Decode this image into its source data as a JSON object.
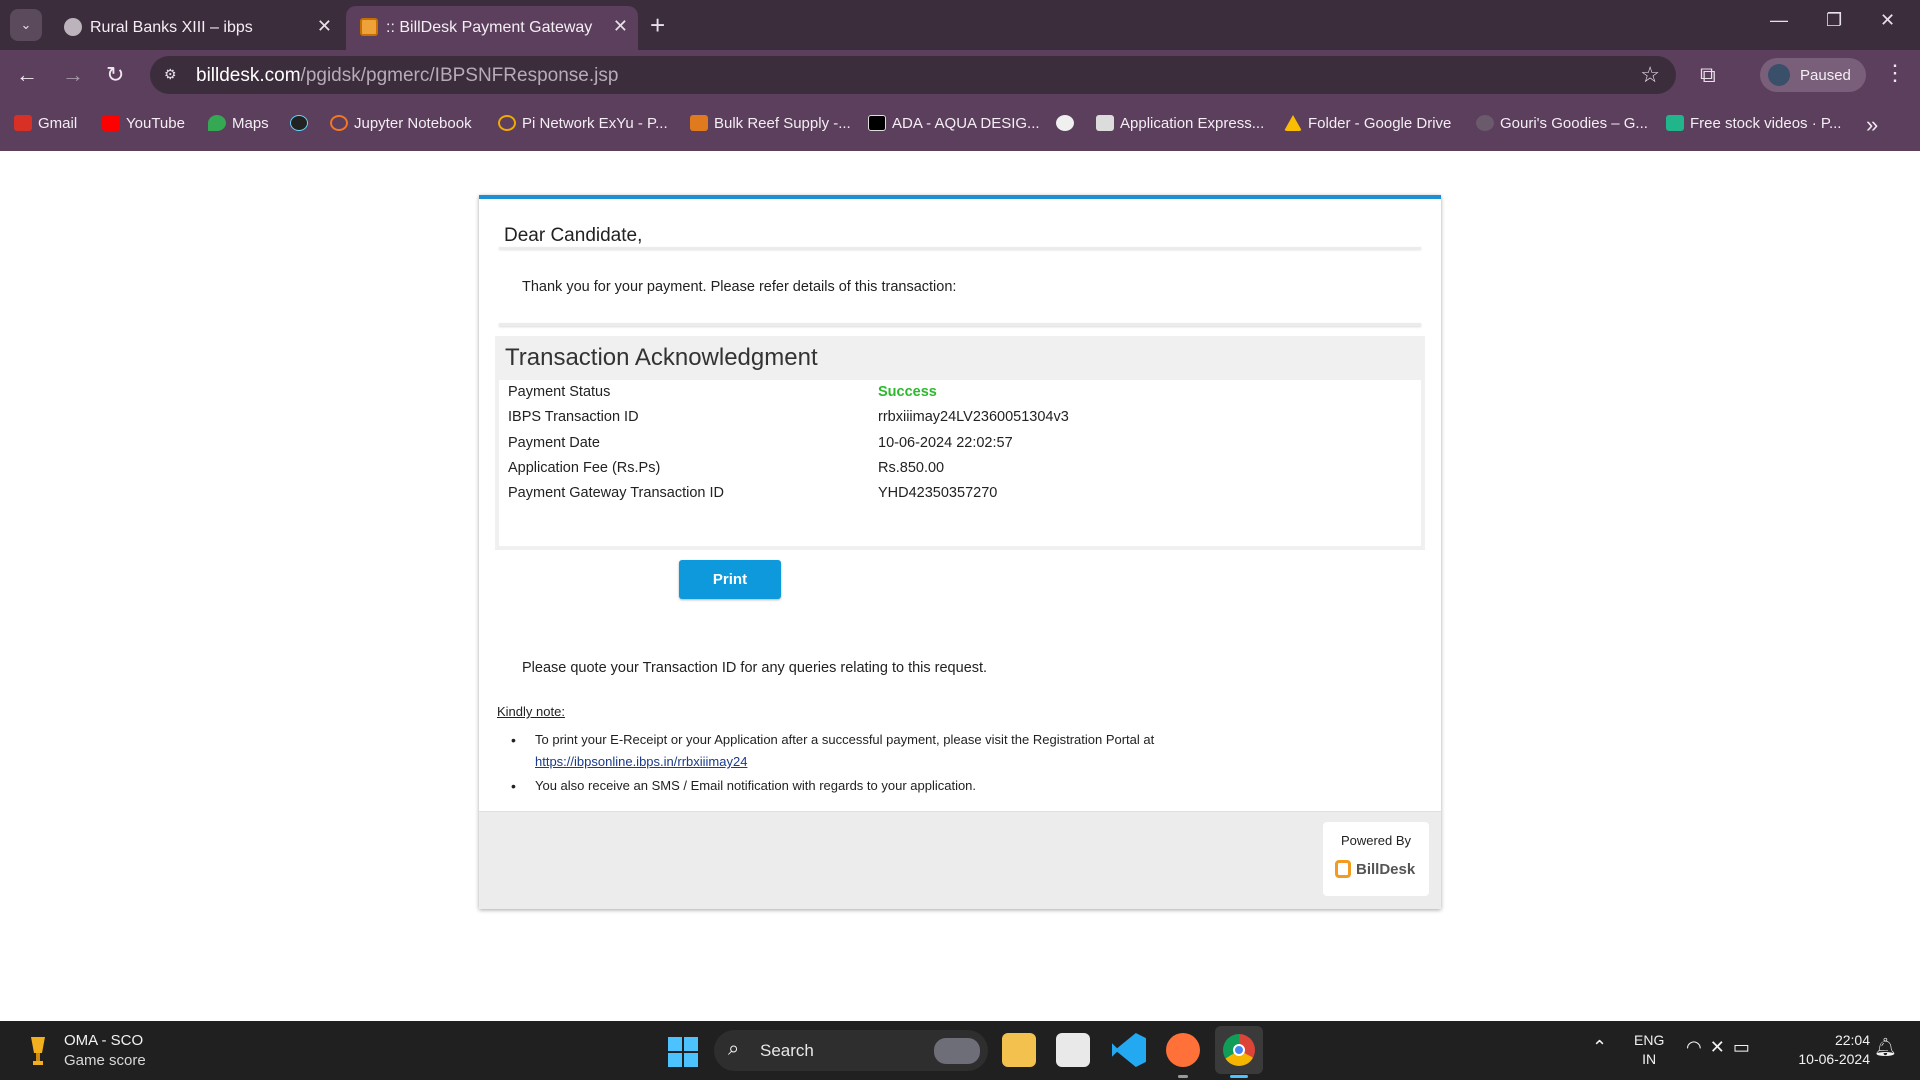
{
  "browser": {
    "tabs": [
      {
        "title": "Rural Banks XIII – ibps",
        "icon": "globe-icon"
      },
      {
        "title": ":: BillDesk Payment Gateway ::",
        "icon": "billdesk-icon"
      }
    ],
    "url_host": "billdesk.com",
    "url_path": "/pgidsk/pgmerc/IBPSNFResponse.jsp",
    "profile_label": "Paused",
    "bookmarks": [
      {
        "label": "Gmail"
      },
      {
        "label": "YouTube"
      },
      {
        "label": "Maps"
      },
      {
        "label": ""
      },
      {
        "label": "Jupyter Notebook"
      },
      {
        "label": "Pi Network ExYu - P..."
      },
      {
        "label": "Bulk Reef Supply -..."
      },
      {
        "label": "ADA - AQUA DESIG..."
      },
      {
        "label": ""
      },
      {
        "label": "Application Express..."
      },
      {
        "label": "Folder - Google Drive"
      },
      {
        "label": "Gouri's Goodies – G..."
      },
      {
        "label": "Free stock videos · P..."
      }
    ]
  },
  "page": {
    "greeting": "Dear Candidate,",
    "intro": "Thank you for your payment. Please refer details of this transaction:",
    "ack_title": "Transaction Acknowledgment",
    "rows": [
      {
        "label": "Payment Status",
        "value": "Success"
      },
      {
        "label": "IBPS Transaction ID",
        "value": "rrbxiiimay24LV2360051304v3"
      },
      {
        "label": "Payment Date",
        "value": "10-06-2024 22:02:57"
      },
      {
        "label": "Application Fee (Rs.Ps)",
        "value": "Rs.850.00"
      },
      {
        "label": "Payment Gateway Transaction ID",
        "value": "YHD42350357270"
      }
    ],
    "print_label": "Print",
    "quote_text": "Please quote your Transaction ID for any queries relating to this request.",
    "note_title": "Kindly note:",
    "note_1_text": "To print your E-Receipt or your Application after a successful payment, please visit the Registration Portal at",
    "note_1_link": "https://ibpsonline.ibps.in/rrbxiiimay24",
    "note_2_text": "You also receive an SMS / Email notification with regards to your application.",
    "powered_by": "Powered By",
    "brand": "BillDesk"
  },
  "taskbar": {
    "weather_title": "OMA - SCO",
    "weather_sub": "Game score",
    "search_label": "Search",
    "lang_1": "ENG",
    "lang_2": "IN",
    "time": "22:04",
    "date": "10-06-2024"
  },
  "colors": {
    "accent": "#1a8fd4",
    "success": "#2eb82e",
    "button": "#0e99dc",
    "billdesk_orange": "#f39a21"
  }
}
